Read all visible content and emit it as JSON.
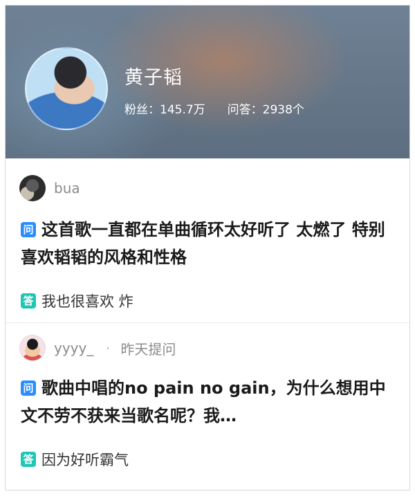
{
  "profile": {
    "name": "黄子韬",
    "fans_label": "粉丝：145.7万",
    "qa_label": "问答：2938个"
  },
  "posts": [
    {
      "user": "bua",
      "asked": "",
      "q_badge": "问",
      "question": "这首歌一直都在单曲循环太好听了 太燃了 特别喜欢韬韬的风格和性格",
      "a_badge": "答",
      "answer": "我也很喜欢 炸"
    },
    {
      "user": "yyyy_",
      "dot": "·",
      "asked": "昨天提问",
      "q_badge": "问",
      "question": "歌曲中唱的no pain no gain，为什么想用中文不劳不获来当歌名呢？我…",
      "a_badge": "答",
      "answer": "因为好听霸气"
    }
  ],
  "colors": {
    "question_badge": "#2a8cff",
    "answer_badge": "#20c5b4",
    "header_bg": "#65788b"
  }
}
